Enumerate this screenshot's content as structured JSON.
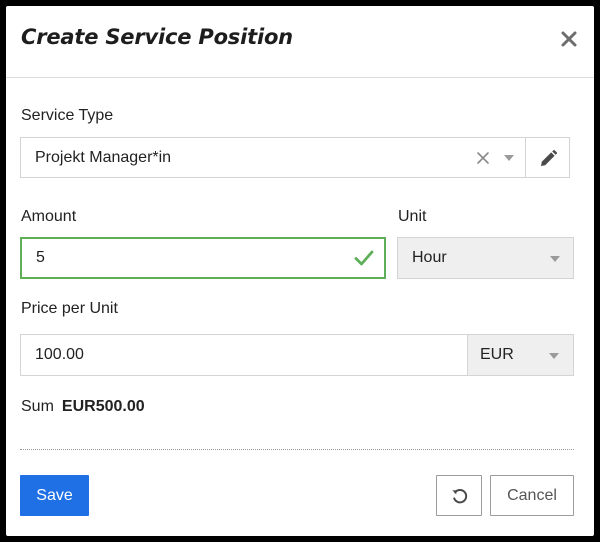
{
  "dialog": {
    "title": "Create Service Position",
    "close_icon": "close-icon"
  },
  "service_type": {
    "label": "Service Type",
    "value": "Projekt Manager*in",
    "clear_icon": "clear-icon",
    "caret_icon": "chevron-down-icon",
    "edit_icon": "pencil-icon"
  },
  "amount": {
    "label": "Amount",
    "value": "5",
    "valid_icon": "checkmark-icon",
    "valid_color": "#5fae5a"
  },
  "unit": {
    "label": "Unit",
    "value": "Hour"
  },
  "price": {
    "label": "Price per Unit",
    "value": "100.00",
    "currency": "EUR"
  },
  "sum": {
    "label": "Sum",
    "value": "EUR500.00"
  },
  "actions": {
    "save_label": "Save",
    "reset_icon": "reset-icon",
    "cancel_label": "Cancel",
    "primary_color": "#1f6fe5"
  }
}
